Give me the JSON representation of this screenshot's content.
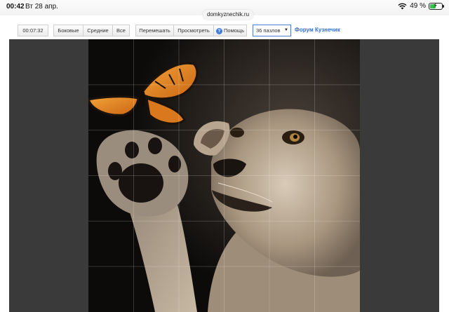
{
  "status_bar": {
    "time": "00:42",
    "date": "Вт 28 апр.",
    "battery_percent_text": "49 %",
    "battery_level": 0.49,
    "wifi_icon": "wifi-icon",
    "battery_icon": "battery-charging-icon"
  },
  "browser": {
    "url": "domkyznechik.ru"
  },
  "toolbar": {
    "timer": "00:07:32",
    "piece_filters": [
      "Боковые",
      "Средние",
      "Все"
    ],
    "actions": {
      "shuffle": "Перемешать",
      "preview": "Просмотреть",
      "help": "Помощь"
    },
    "help_icon": "question-circle-icon",
    "puzzle_count_selected": "36 пазлов",
    "forum_link": "Форум Кузнечик"
  },
  "puzzle": {
    "pieces": 36,
    "grid": [
      6,
      6
    ],
    "image_subject": "lion cub reaching for a butterfly",
    "colors": {
      "board_bg": "#3a3a3a",
      "image_bg": "#0e0d0c",
      "butterfly": "#e0801e",
      "fur": "#b7a58f"
    }
  }
}
